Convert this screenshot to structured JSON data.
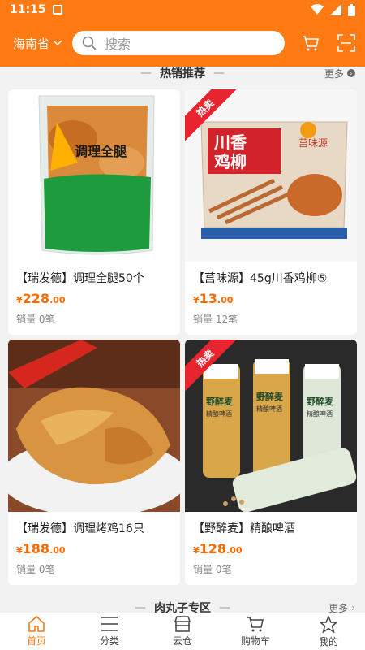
{
  "status": {
    "time": "11:15"
  },
  "header": {
    "region": "海南省",
    "search_placeholder": "搜索"
  },
  "hot_section": {
    "title": "热销推荐",
    "more": "更多"
  },
  "products": [
    {
      "name": "【瑞发德】调理全腿50个",
      "price_int": "228",
      "price_dec": ".00",
      "currency": "¥",
      "sales": "销量 0笔",
      "hot": false,
      "badge": ""
    },
    {
      "name": "【莒味源】45g川香鸡柳⑤",
      "price_int": "13",
      "price_dec": ".00",
      "currency": "¥",
      "sales": "销量 12笔",
      "hot": true,
      "badge": "热卖"
    },
    {
      "name": "【瑞发德】调理烤鸡16只",
      "price_int": "188",
      "price_dec": ".00",
      "currency": "¥",
      "sales": "销量 0笔",
      "hot": false,
      "badge": ""
    },
    {
      "name": "【野醉麦】精酿啤酒",
      "price_int": "128",
      "price_dec": ".00",
      "currency": "¥",
      "sales": "销量 0笔",
      "hot": true,
      "badge": "热卖"
    }
  ],
  "package_text": {
    "p1": "调理全腿",
    "p2_line1": "川香",
    "p2_line2": "鸡柳",
    "p2_brand": "莒味源",
    "beer_brand": "野醉麦",
    "beer_sub": "精酿啤酒"
  },
  "meatball_section": {
    "title": "肉丸子专区",
    "more": "更多"
  },
  "tabs": [
    {
      "label": "首页",
      "icon": "home-icon"
    },
    {
      "label": "分类",
      "icon": "list-icon"
    },
    {
      "label": "云仓",
      "icon": "store-icon"
    },
    {
      "label": "购物车",
      "icon": "cart-icon"
    },
    {
      "label": "我的",
      "icon": "star-icon"
    }
  ],
  "colors": {
    "brand": "#ff7a12",
    "price": "#ff6a00",
    "hot_badge": "#e8242f"
  }
}
